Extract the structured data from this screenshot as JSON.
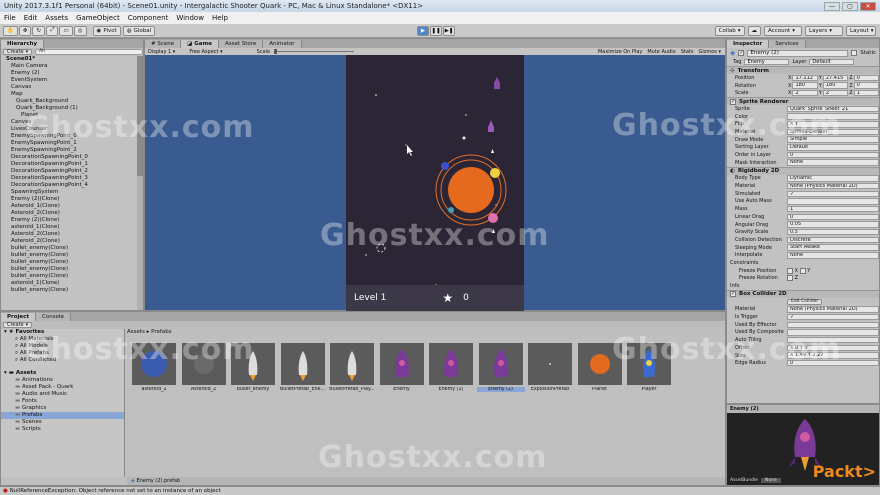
{
  "window": {
    "title": "Unity 2017.3.1f1 Personal (64bit) - Scene01.unity - Intergalactic Shooter Quark - PC, Mac & Linux Standalone* <DX11>"
  },
  "menu": [
    "File",
    "Edit",
    "Assets",
    "GameObject",
    "Component",
    "Window",
    "Help"
  ],
  "toolbar": {
    "pivot": "Pivot",
    "global": "Global",
    "collab": "Collab",
    "account": "Account",
    "layers": "Layers",
    "layout": "Layout"
  },
  "hierarchy": {
    "tab": "Hierarchy",
    "create": "Create",
    "search": "All",
    "items": [
      {
        "label": "Scene01*",
        "indent": 0
      },
      {
        "label": "Main Camera",
        "indent": 1
      },
      {
        "label": "Enemy (2)",
        "indent": 1
      },
      {
        "label": "EventSystem",
        "indent": 1
      },
      {
        "label": "Canvas",
        "indent": 1
      },
      {
        "label": "Map",
        "indent": 1
      },
      {
        "label": "Quark_Background",
        "indent": 2
      },
      {
        "label": "Quark_Background (1)",
        "indent": 2
      },
      {
        "label": "Planet",
        "indent": 3
      },
      {
        "label": "Canvas",
        "indent": 1
      },
      {
        "label": "LivesCounter",
        "indent": 1
      },
      {
        "label": "EnemySpawningPoint_0",
        "indent": 1
      },
      {
        "label": "EnemySpawningPoint_1",
        "indent": 1
      },
      {
        "label": "EnemySpawningPoint_2",
        "indent": 1
      },
      {
        "label": "DecorationSpawningPoint_0",
        "indent": 1
      },
      {
        "label": "DecorationSpawningPoint_1",
        "indent": 1
      },
      {
        "label": "DecorationSpawningPoint_2",
        "indent": 1
      },
      {
        "label": "DecorationSpawningPoint_3",
        "indent": 1
      },
      {
        "label": "DecorationSpawningPoint_4",
        "indent": 1
      },
      {
        "label": "SpawningSystem",
        "indent": 1
      },
      {
        "label": "Enemy (2)(Clone)",
        "indent": 1
      },
      {
        "label": "Asteroid_1(Clone)",
        "indent": 1
      },
      {
        "label": "Asteroid_2(Clone)",
        "indent": 1
      },
      {
        "label": "Enemy (2)(Clone)",
        "indent": 1
      },
      {
        "label": "asteroid_1(Clone)",
        "indent": 1
      },
      {
        "label": "Asteroid_2(Clone)",
        "indent": 1
      },
      {
        "label": "Asteroid_2(Clone)",
        "indent": 1
      },
      {
        "label": "bullet_enemy(Clone)",
        "indent": 1
      },
      {
        "label": "bullet_enemy(Clone)",
        "indent": 1
      },
      {
        "label": "bullet_enemy(Clone)",
        "indent": 1
      },
      {
        "label": "bullet_enemy(Clone)",
        "indent": 1
      },
      {
        "label": "bullet_enemy(Clone)",
        "indent": 1
      },
      {
        "label": "asteroid_1(Clone)",
        "indent": 1
      },
      {
        "label": "bullet_enemy(Clone)",
        "indent": 1
      }
    ]
  },
  "sceneTabs": {
    "scene": "Scene",
    "game": "Game",
    "assetStore": "Asset Store",
    "animator": "Animator"
  },
  "gameBar": {
    "display": "Display 1",
    "aspect": "Free Aspect",
    "scale": "Scale",
    "maximize": "Maximize On Play",
    "mute": "Mute Audio",
    "stats": "Stats",
    "gizmos": "Gizmos"
  },
  "game": {
    "level": "Level 1",
    "score": "0"
  },
  "inspector": {
    "tab": "Inspector",
    "services": "Services",
    "name": "Enemy (2)",
    "static": "Static",
    "tag": "Tag",
    "tagVal": "Enemy",
    "layer": "Layer",
    "layerVal": "Default",
    "transform": {
      "title": "Transform",
      "position": [
        "X",
        "17.112",
        "Y",
        "27.415",
        "Z",
        "0"
      ],
      "rotation": [
        "X",
        "180",
        "Y",
        "180",
        "Z",
        "0"
      ],
      "scale": [
        "X",
        "2",
        "Y",
        "2",
        "Z",
        "1"
      ]
    },
    "sprite": {
      "title": "Sprite Renderer",
      "rows": [
        [
          "Sprite",
          "Quark_Sprite_Sheet_21"
        ],
        [
          "Color",
          ""
        ],
        [
          "Flip",
          "X  Y"
        ],
        [
          "Material",
          "Sprites-Default"
        ],
        [
          "Draw Mode",
          "Simple"
        ],
        [
          "Sorting Layer",
          "Default"
        ],
        [
          "Order in Layer",
          "0"
        ],
        [
          "Mask Interaction",
          "None"
        ]
      ]
    },
    "rigid": {
      "title": "Rigidbody 2D",
      "rows": [
        [
          "Body Type",
          "Dynamic"
        ],
        [
          "Material",
          "None (Physics Material 2D)"
        ],
        [
          "Simulated",
          "✓"
        ],
        [
          "Use Auto Mass",
          ""
        ],
        [
          "Mass",
          "1"
        ],
        [
          "Linear Drag",
          "0"
        ],
        [
          "Angular Drag",
          "0.05"
        ],
        [
          "Gravity Scale",
          "0.5"
        ],
        [
          "Collision Detection",
          "Discrete"
        ],
        [
          "Sleeping Mode",
          "Start Awake"
        ],
        [
          "Interpolate",
          "None"
        ]
      ],
      "constraints": "Constraints",
      "freezePos": "Freeze Position",
      "freezeRot": "Freeze Rotation",
      "info": "Info"
    },
    "box": {
      "title": "Box Collider 2D",
      "editCollider": "Edit Collider",
      "rows": [
        [
          "Material",
          "None (Physics Material 2D)"
        ],
        [
          "Is Trigger",
          "✓"
        ],
        [
          "Used By Effector",
          ""
        ],
        [
          "Used By Composite",
          ""
        ],
        [
          "Auto Tiling",
          ""
        ],
        [
          "Offset",
          "X 0   Y 0"
        ],
        [
          "Size",
          "X 1.49  Y 2.27"
        ],
        [
          "Edge Radius",
          "0"
        ]
      ]
    },
    "previewTitle": "Enemy (2)",
    "assetBundle": "AssetBundle",
    "none": "None"
  },
  "project": {
    "tab": "Project",
    "console": "Console",
    "create": "Create",
    "favorites": {
      "title": "Favorites",
      "items": [
        "All Materials",
        "All Models",
        "All Prefabs",
        "All Conflicted"
      ]
    },
    "assets": {
      "title": "Assets",
      "items": [
        "Animations",
        "Asset Pack - Quark",
        "Audio and Music",
        "Fonts",
        "Graphics",
        "Prefabs",
        "Scenes",
        "Scripts"
      ]
    },
    "breadcrumb": "Assets ▸ Prefabs",
    "prefabs": [
      "asteroid_1",
      "Asteroid_2",
      "bullet_enemy",
      "BulletPrefab_Ene...",
      "BulletPrefab_Play...",
      "Enemy",
      "Enemy (1)",
      "Enemy (2)",
      "ExplosionPrefab",
      "Planet",
      "Player"
    ],
    "footer": "Enemy (2).prefab"
  },
  "status": {
    "error": "NullReferenceException: Object reference not set to an instance of an object"
  },
  "watermark": "Ghostxx.com",
  "brand": "Packt>"
}
